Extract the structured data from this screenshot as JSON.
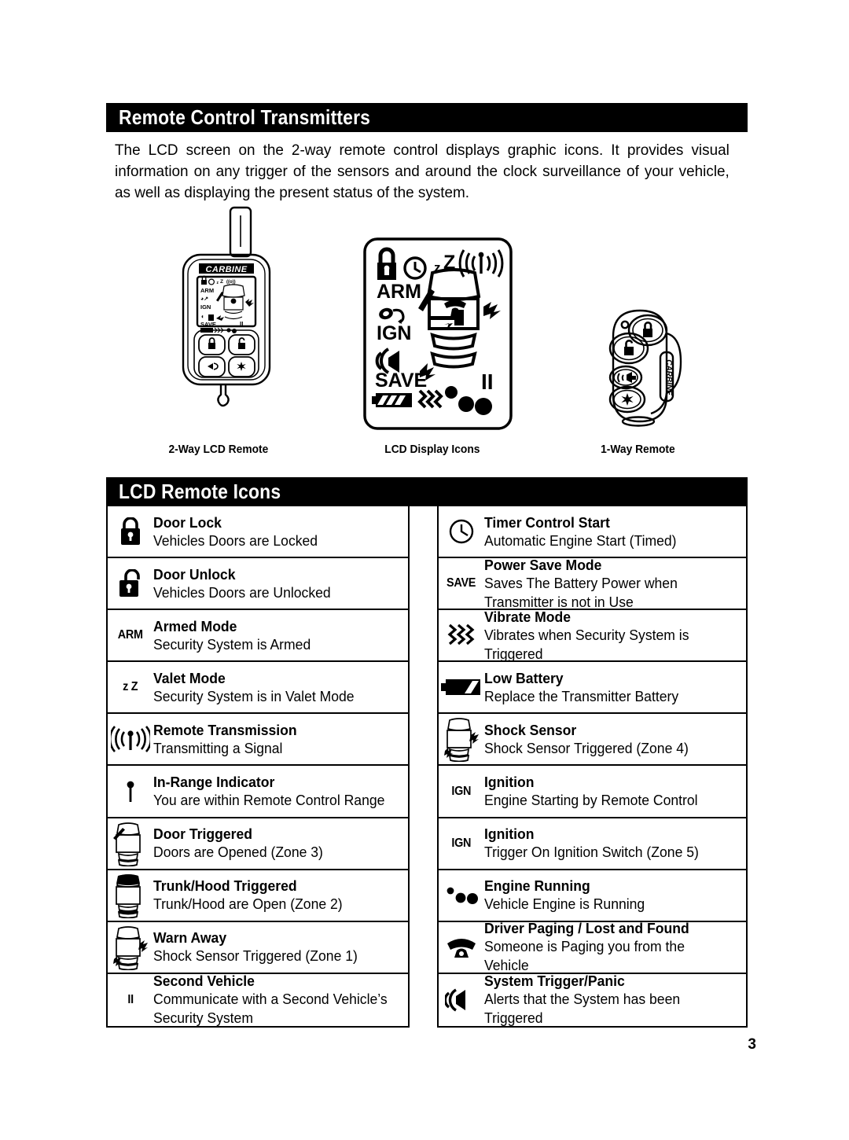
{
  "header": {
    "section_title": "Remote Control Transmitters",
    "intro": "The LCD screen on the 2-way remote control displays graphic icons. It provides visual information on any trigger of the sensors and around the clock surveillance of your vehicle, as well as displaying the present status of the system."
  },
  "figures": [
    {
      "id": "2way-lcd-remote",
      "caption": "2-Way LCD Remote",
      "brand": "CARBINE"
    },
    {
      "id": "lcd-display-icons",
      "caption": "LCD Display Icons"
    },
    {
      "id": "1way-remote",
      "caption": "1-Way Remote",
      "brand": "CARBINE"
    }
  ],
  "icons_section": {
    "title": "LCD Remote Icons",
    "left_rows": [
      {
        "icon": "padlock-closed-icon",
        "title": "Door Lock",
        "desc": "Vehicles Doors are Locked"
      },
      {
        "icon": "padlock-open-icon",
        "title": "Door Unlock",
        "desc": "Vehicles Doors are Unlocked"
      },
      {
        "icon": "arm-text-icon",
        "icon_text": "ARM",
        "title": "Armed Mode",
        "desc": "Security System is Armed"
      },
      {
        "icon": "valet-zz-icon",
        "icon_text": "z Z",
        "title": "Valet Mode",
        "desc": "Security System is in Valet Mode"
      },
      {
        "icon": "antenna-transmit-icon",
        "title": "Remote Transmission",
        "desc": "Transmitting a Signal"
      },
      {
        "icon": "in-range-pin-icon",
        "title": "In-Range Indicator",
        "desc": "You are within Remote Control Range"
      },
      {
        "icon": "car-door-triggered-icon",
        "title": "Door Triggered",
        "desc": "Doors are Opened (Zone 3)"
      },
      {
        "icon": "car-trunk-hood-icon",
        "title": "Trunk/Hood Triggered",
        "desc": "Trunk/Hood are Open (Zone 2)"
      },
      {
        "icon": "car-warn-away-icon",
        "title": "Warn Away",
        "desc": "Shock Sensor Triggered (Zone 1)"
      },
      {
        "icon": "second-vehicle-ii-icon",
        "icon_text": "II",
        "title": "Second Vehicle",
        "desc": "Communicate with a Second Vehicle’s Security System"
      }
    ],
    "right_rows": [
      {
        "icon": "clock-timer-icon",
        "title": "Timer Control Start",
        "desc": "Automatic Engine Start (Timed)"
      },
      {
        "icon": "save-text-icon",
        "icon_text": "SAVE",
        "title": "Power Save Mode",
        "desc": "Saves The Battery Power when Transmitter is not in Use"
      },
      {
        "icon": "vibrate-waves-icon",
        "title": "Vibrate Mode",
        "desc": "Vibrates when Security System is Triggered"
      },
      {
        "icon": "low-battery-icon",
        "title": "Low Battery",
        "desc": "Replace the Transmitter Battery"
      },
      {
        "icon": "car-shock-sensor-icon",
        "title": "Shock Sensor",
        "desc": "Shock Sensor Triggered (Zone 4)"
      },
      {
        "icon": "ignition-key-icon",
        "icon_text": "IGN",
        "title": "Ignition",
        "desc": "Engine Starting by Remote Control"
      },
      {
        "icon": "ignition-key-icon",
        "icon_text": "IGN",
        "title": "Ignition",
        "desc": "Trigger On Ignition Switch (Zone 5)"
      },
      {
        "icon": "engine-running-icon",
        "title": "Engine Running",
        "desc": "Vehicle Engine is Running"
      },
      {
        "icon": "telephone-paging-icon",
        "title": "Driver Paging / Lost and Found",
        "desc": "Someone is Paging you from the Vehicle"
      },
      {
        "icon": "siren-speaker-icon",
        "title": "System Trigger/Panic",
        "desc": "Alerts that the System has been Triggered"
      }
    ]
  },
  "page_number": "3"
}
